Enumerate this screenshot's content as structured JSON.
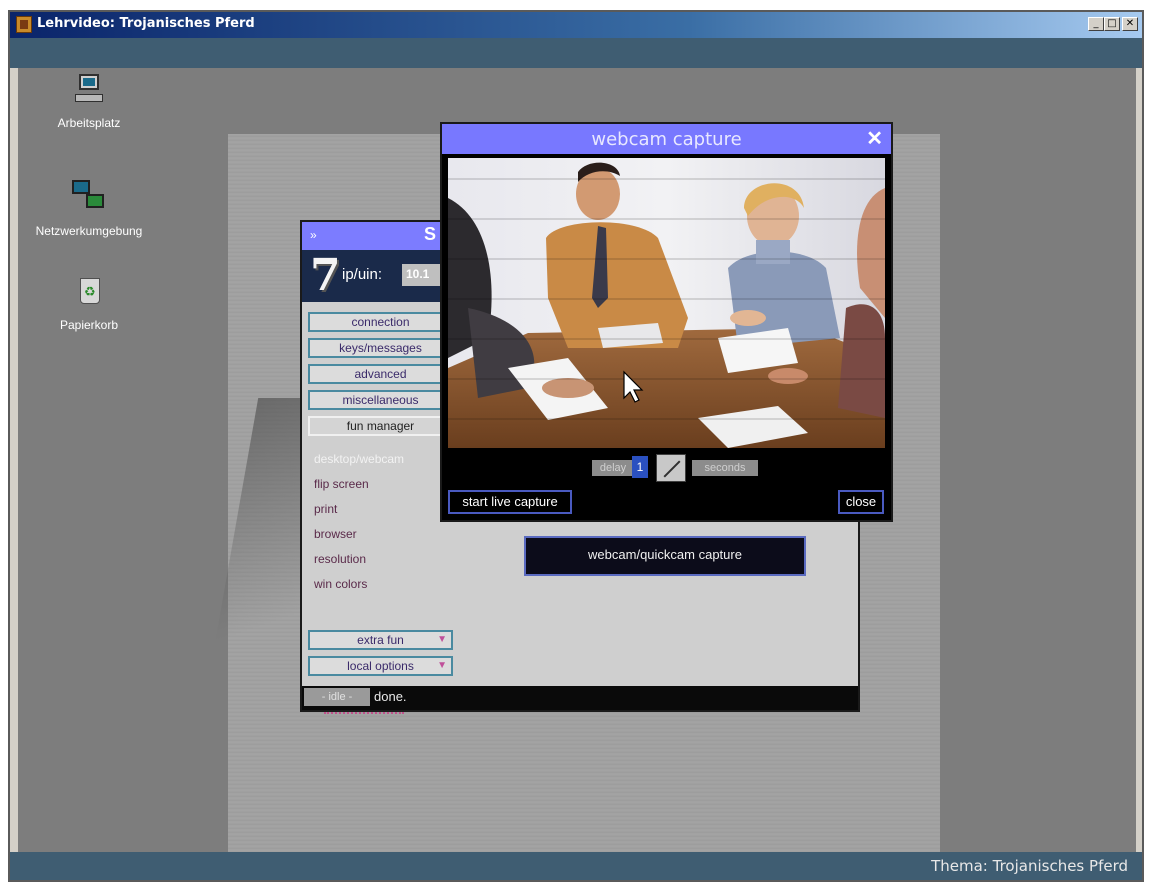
{
  "window": {
    "title": "Lehrvideo: Trojanisches Pferd",
    "minimize": "_",
    "maximize": "□",
    "close": "✕"
  },
  "desktop_icons": [
    {
      "label": "Arbeitsplatz",
      "icon": "computer-icon"
    },
    {
      "label": "Netzwerkumgebung",
      "icon": "network-icon"
    },
    {
      "label": "Papierkorb",
      "icon": "recycle-bin-icon"
    }
  ],
  "footer": {
    "text": "Thema: Trojanisches Pferd"
  },
  "sub7": {
    "title_arrow": "»",
    "title_letter": "S",
    "logo": "7",
    "ip_label": "ip/uin:",
    "ip_value": "10.1",
    "buttons": [
      "connection",
      "keys/messages",
      "advanced",
      "miscellaneous",
      "fun manager"
    ],
    "links": [
      "desktop/webcam",
      "flip screen",
      "print",
      "browser",
      "resolution",
      "win colors"
    ],
    "dropdowns": [
      {
        "label": "extra fun"
      },
      {
        "label": "local options"
      }
    ],
    "webcam_quickcam": "webcam/quickcam capture",
    "status_idle": "- idle -",
    "status_message": "done."
  },
  "webcam_window": {
    "title": "webcam capture",
    "close": "✕",
    "delay_label": "delay",
    "delay_value": "1",
    "seconds_label": "seconds",
    "start_button": "start live capture",
    "close_button": "close"
  },
  "colors": {
    "title_accent": "#7878ff",
    "desktop_bg": "#7d7d7d",
    "band_bg": "#3f5d72"
  }
}
